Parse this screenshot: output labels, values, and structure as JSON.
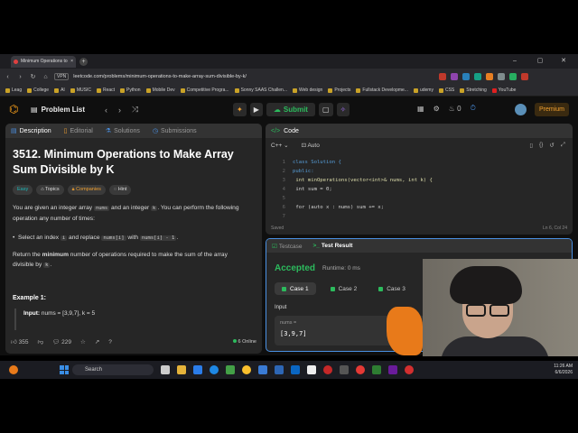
{
  "browser": {
    "tab_title": "Minimum Operations to M",
    "url": "leetcode.com/problems/minimum-operations-to-make-array-sum-divisible-by-k/",
    "vpn": "VPN",
    "bookmarks": [
      "Leag",
      "College",
      "AI",
      "MUSIC",
      "React",
      "Python",
      "Mobile Dev",
      "Competitive Progra...",
      "Sonny SAAS Challen...",
      "Web design",
      "Projects",
      "Fullstack Developme...",
      "udemy",
      "CSS",
      "Stretching",
      "YouTube"
    ]
  },
  "header": {
    "problem_list": "Problem List",
    "submit": "Submit",
    "premium": "Premium",
    "streak": "0"
  },
  "description_panel": {
    "tabs": [
      "Description",
      "Editorial",
      "Solutions",
      "Submissions"
    ],
    "title": "3512. Minimum Operations to Make Array Sum Divisible by K",
    "tags": [
      "Easy",
      "Topics",
      "Companies",
      "Hint"
    ],
    "para1_a": "You are given an integer array ",
    "para1_nums": "nums",
    "para1_b": " and an integer ",
    "para1_k": "k",
    "para1_c": ". You can perform the following operation any number of times:",
    "bullet_a": "Select an index ",
    "bullet_i": "i",
    "bullet_b": " and replace ",
    "bullet_code1": "nums[i]",
    "bullet_c": " with ",
    "bullet_code2": "nums[i] - 1",
    "bullet_d": ".",
    "para2_a": "Return the ",
    "para2_bold": "minimum",
    "para2_b": " number of operations required to make the sum of the array divisible by ",
    "para2_k": "k",
    "para2_c": ".",
    "example_title": "Example 1:",
    "example_input_label": "Input:",
    "example_input_value": "nums = [3,9,7], k = 5",
    "likes": "355",
    "comments": "229",
    "online": "6 Online"
  },
  "code_panel": {
    "tab": "Code",
    "language": "C++",
    "mode": "Auto",
    "lines": [
      {
        "n": "1",
        "text": "class Solution {"
      },
      {
        "n": "2",
        "text": "public:"
      },
      {
        "n": "3",
        "text": "    int minOperations(vector<int>& nums, int k) {"
      },
      {
        "n": "4",
        "text": "        int sum = 0;"
      },
      {
        "n": "5",
        "text": ""
      },
      {
        "n": "6",
        "text": "        for (auto x : nums) sum += x;"
      },
      {
        "n": "7",
        "text": ""
      }
    ],
    "status": "Saved",
    "cursor": "Ln 6, Col 24"
  },
  "result_panel": {
    "tabs": [
      "Testcase",
      "Test Result"
    ],
    "status": "Accepted",
    "runtime": "Runtime: 0 ms",
    "cases": [
      "Case 1",
      "Case 2",
      "Case 3"
    ],
    "input_label": "Input",
    "input_key": "nums =",
    "input_value": "[3,9,7]"
  },
  "taskbar": {
    "search": "Search",
    "time": "11:26 AM",
    "date": "6/6/2026"
  }
}
